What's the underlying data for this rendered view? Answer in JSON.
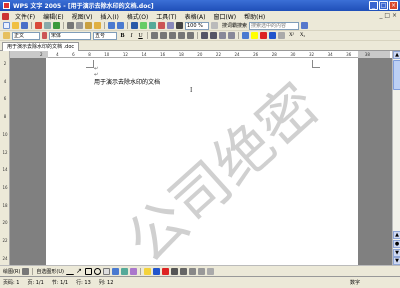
{
  "window": {
    "title": "WPS 文字 2005 - [用于演示去除水印的文档.doc]"
  },
  "menu": {
    "items": [
      "文件(F)",
      "编辑(E)",
      "视图(V)",
      "插入(I)",
      "格式(O)",
      "工具(T)",
      "表格(A)",
      "窗口(W)",
      "帮助(H)"
    ]
  },
  "toolbar_standard": {
    "zoom": "100 %",
    "search_label": "搜词霸搜索",
    "search_placeholder": "搜索选中的内容"
  },
  "toolbar_format": {
    "style": "正文",
    "font": "宋体",
    "size": "五号",
    "bold": "B",
    "italic": "I",
    "underline": "U",
    "superscript": "X²",
    "subscript": "X₂"
  },
  "document_tab": {
    "label": "用于演示去除水印的文档 .doc"
  },
  "ruler": {
    "h_ticks": [
      "2",
      "4",
      "6",
      "8",
      "10",
      "12",
      "14",
      "16",
      "18",
      "20",
      "22",
      "24",
      "26",
      "28",
      "30",
      "32",
      "34",
      "36",
      "38"
    ],
    "v_ticks": [
      "2",
      "4",
      "6",
      "8",
      "10",
      "12",
      "14",
      "16",
      "18",
      "20",
      "22",
      "24"
    ]
  },
  "document": {
    "body_text": "用于演示去除水印的文档",
    "watermark": "公司绝密"
  },
  "drawbar": {
    "draw_label": "绘图(R)",
    "autoshape_label": "自选图形(U)"
  },
  "status": {
    "page": "页码: 1",
    "page_of": "页: 1/1",
    "section": "节: 1/1",
    "line": "行: 13",
    "col": "列: 12",
    "mode": "数字"
  },
  "colors": {
    "title_bar": "#1f4fb8",
    "chrome": "#ece9d8",
    "watermark": "#d0d0d0",
    "doc_bg": "#808080"
  }
}
